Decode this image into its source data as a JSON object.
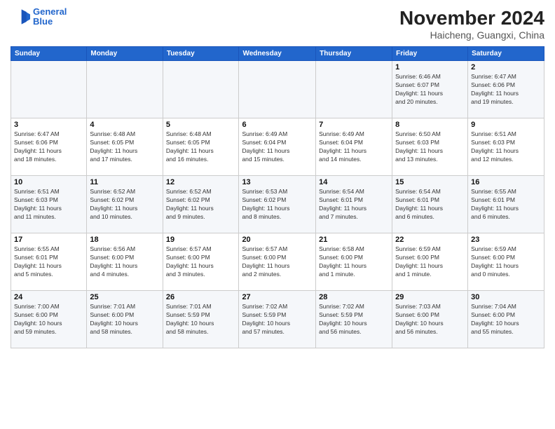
{
  "header": {
    "logo_line1": "General",
    "logo_line2": "Blue",
    "month": "November 2024",
    "location": "Haicheng, Guangxi, China"
  },
  "days_of_week": [
    "Sunday",
    "Monday",
    "Tuesday",
    "Wednesday",
    "Thursday",
    "Friday",
    "Saturday"
  ],
  "weeks": [
    [
      {
        "day": "",
        "info": ""
      },
      {
        "day": "",
        "info": ""
      },
      {
        "day": "",
        "info": ""
      },
      {
        "day": "",
        "info": ""
      },
      {
        "day": "",
        "info": ""
      },
      {
        "day": "1",
        "info": "Sunrise: 6:46 AM\nSunset: 6:07 PM\nDaylight: 11 hours\nand 20 minutes."
      },
      {
        "day": "2",
        "info": "Sunrise: 6:47 AM\nSunset: 6:06 PM\nDaylight: 11 hours\nand 19 minutes."
      }
    ],
    [
      {
        "day": "3",
        "info": "Sunrise: 6:47 AM\nSunset: 6:06 PM\nDaylight: 11 hours\nand 18 minutes."
      },
      {
        "day": "4",
        "info": "Sunrise: 6:48 AM\nSunset: 6:05 PM\nDaylight: 11 hours\nand 17 minutes."
      },
      {
        "day": "5",
        "info": "Sunrise: 6:48 AM\nSunset: 6:05 PM\nDaylight: 11 hours\nand 16 minutes."
      },
      {
        "day": "6",
        "info": "Sunrise: 6:49 AM\nSunset: 6:04 PM\nDaylight: 11 hours\nand 15 minutes."
      },
      {
        "day": "7",
        "info": "Sunrise: 6:49 AM\nSunset: 6:04 PM\nDaylight: 11 hours\nand 14 minutes."
      },
      {
        "day": "8",
        "info": "Sunrise: 6:50 AM\nSunset: 6:03 PM\nDaylight: 11 hours\nand 13 minutes."
      },
      {
        "day": "9",
        "info": "Sunrise: 6:51 AM\nSunset: 6:03 PM\nDaylight: 11 hours\nand 12 minutes."
      }
    ],
    [
      {
        "day": "10",
        "info": "Sunrise: 6:51 AM\nSunset: 6:03 PM\nDaylight: 11 hours\nand 11 minutes."
      },
      {
        "day": "11",
        "info": "Sunrise: 6:52 AM\nSunset: 6:02 PM\nDaylight: 11 hours\nand 10 minutes."
      },
      {
        "day": "12",
        "info": "Sunrise: 6:52 AM\nSunset: 6:02 PM\nDaylight: 11 hours\nand 9 minutes."
      },
      {
        "day": "13",
        "info": "Sunrise: 6:53 AM\nSunset: 6:02 PM\nDaylight: 11 hours\nand 8 minutes."
      },
      {
        "day": "14",
        "info": "Sunrise: 6:54 AM\nSunset: 6:01 PM\nDaylight: 11 hours\nand 7 minutes."
      },
      {
        "day": "15",
        "info": "Sunrise: 6:54 AM\nSunset: 6:01 PM\nDaylight: 11 hours\nand 6 minutes."
      },
      {
        "day": "16",
        "info": "Sunrise: 6:55 AM\nSunset: 6:01 PM\nDaylight: 11 hours\nand 6 minutes."
      }
    ],
    [
      {
        "day": "17",
        "info": "Sunrise: 6:55 AM\nSunset: 6:01 PM\nDaylight: 11 hours\nand 5 minutes."
      },
      {
        "day": "18",
        "info": "Sunrise: 6:56 AM\nSunset: 6:00 PM\nDaylight: 11 hours\nand 4 minutes."
      },
      {
        "day": "19",
        "info": "Sunrise: 6:57 AM\nSunset: 6:00 PM\nDaylight: 11 hours\nand 3 minutes."
      },
      {
        "day": "20",
        "info": "Sunrise: 6:57 AM\nSunset: 6:00 PM\nDaylight: 11 hours\nand 2 minutes."
      },
      {
        "day": "21",
        "info": "Sunrise: 6:58 AM\nSunset: 6:00 PM\nDaylight: 11 hours\nand 1 minute."
      },
      {
        "day": "22",
        "info": "Sunrise: 6:59 AM\nSunset: 6:00 PM\nDaylight: 11 hours\nand 1 minute."
      },
      {
        "day": "23",
        "info": "Sunrise: 6:59 AM\nSunset: 6:00 PM\nDaylight: 11 hours\nand 0 minutes."
      }
    ],
    [
      {
        "day": "24",
        "info": "Sunrise: 7:00 AM\nSunset: 6:00 PM\nDaylight: 10 hours\nand 59 minutes."
      },
      {
        "day": "25",
        "info": "Sunrise: 7:01 AM\nSunset: 6:00 PM\nDaylight: 10 hours\nand 58 minutes."
      },
      {
        "day": "26",
        "info": "Sunrise: 7:01 AM\nSunset: 5:59 PM\nDaylight: 10 hours\nand 58 minutes."
      },
      {
        "day": "27",
        "info": "Sunrise: 7:02 AM\nSunset: 5:59 PM\nDaylight: 10 hours\nand 57 minutes."
      },
      {
        "day": "28",
        "info": "Sunrise: 7:02 AM\nSunset: 5:59 PM\nDaylight: 10 hours\nand 56 minutes."
      },
      {
        "day": "29",
        "info": "Sunrise: 7:03 AM\nSunset: 6:00 PM\nDaylight: 10 hours\nand 56 minutes."
      },
      {
        "day": "30",
        "info": "Sunrise: 7:04 AM\nSunset: 6:00 PM\nDaylight: 10 hours\nand 55 minutes."
      }
    ]
  ]
}
